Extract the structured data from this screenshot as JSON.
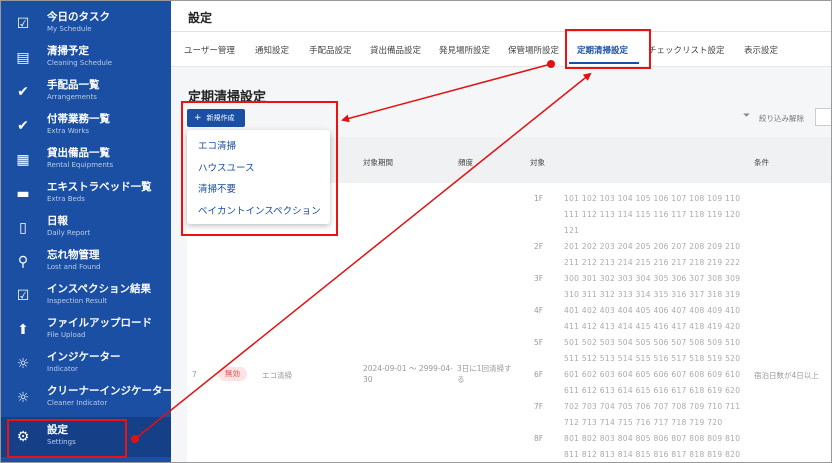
{
  "sidebar": {
    "items": [
      {
        "label": "今日のタスク",
        "sub": "My Schedule",
        "icon": "calendar-check-icon",
        "glyph": "☑"
      },
      {
        "label": "清掃予定",
        "sub": "Cleaning Schedule",
        "icon": "calendar-edit-icon",
        "glyph": "▤"
      },
      {
        "label": "手配品一覧",
        "sub": "Arrangements",
        "icon": "clipboard-check-icon",
        "glyph": "✔"
      },
      {
        "label": "付帯業務一覧",
        "sub": "Extra Works",
        "icon": "clipboard-check-icon",
        "glyph": "✔"
      },
      {
        "label": "貸出備品一覧",
        "sub": "Rental Equipments",
        "icon": "building-icon",
        "glyph": "▦"
      },
      {
        "label": "エキストラベッド一覧",
        "sub": "Extra Beds",
        "icon": "bed-icon",
        "glyph": "▬"
      },
      {
        "label": "日報",
        "sub": "Daily Report",
        "icon": "clipboard-icon",
        "glyph": "▯"
      },
      {
        "label": "忘れ物管理",
        "sub": "Lost and Found",
        "icon": "search-icon",
        "glyph": "⚲"
      },
      {
        "label": "インスペクション結果",
        "sub": "Inspection Result",
        "icon": "calendar-check-icon",
        "glyph": "☑"
      },
      {
        "label": "ファイルアップロード",
        "sub": "File Upload",
        "icon": "upload-icon",
        "glyph": "⬆"
      },
      {
        "label": "インジケーター",
        "sub": "Indicator",
        "icon": "sun-icon",
        "glyph": "☼"
      },
      {
        "label": "クリーナーインジケーター",
        "sub": "Cleaner Indicator",
        "icon": "sun-icon",
        "glyph": "☼"
      },
      {
        "label": "設定",
        "sub": "Settings",
        "icon": "gear-icon",
        "glyph": "⚙"
      }
    ]
  },
  "header": {
    "title": "設定"
  },
  "tabs": [
    {
      "label": "ユーザー管理"
    },
    {
      "label": "通知設定"
    },
    {
      "label": "手配品設定"
    },
    {
      "label": "貸出備品設定"
    },
    {
      "label": "発見場所設定"
    },
    {
      "label": "保管場所設定"
    },
    {
      "label": "定期清掃設定"
    },
    {
      "label": "チェックリスト設定"
    },
    {
      "label": "表示設定"
    }
  ],
  "active_tab": "定期清掃設定",
  "section": {
    "title": "定期清掃設定",
    "new_button": "新規作成",
    "filter_clear": "絞り込み解除"
  },
  "dropdown": {
    "options": [
      "エコ清掃",
      "ハウスユース",
      "清掃不要",
      "ベイカントインスペクション"
    ]
  },
  "table": {
    "headers": {
      "period": "対象期間",
      "frequency": "頻度",
      "target": "対象",
      "condition": "条件"
    },
    "floors": [
      {
        "floor": "1F",
        "rooms": [
          "101 102 103 104 105 106 107 108 109 110",
          "111 112 113 114 115 116 117 118 119 120",
          "121"
        ]
      },
      {
        "floor": "2F",
        "rooms": [
          "201 202 203 204 205 206 207 208 209 210",
          "211 212 213 214 215 216 217 218 219 222"
        ]
      },
      {
        "floor": "3F",
        "rooms": [
          "300 301 302 303 304 305 306 307 308 309",
          "310 311 312 313 314 315 316 317 318 319"
        ]
      },
      {
        "floor": "4F",
        "rooms": [
          "401 402 403 404 405 406 407 408 409 410",
          "411 412 413 414 415 416 417 418 419 420"
        ]
      },
      {
        "floor": "5F",
        "rooms": [
          "501 502 503 504 505 506 507 508 509 510",
          "511 512 513 514 515 516 517 518 519 520"
        ]
      },
      {
        "floor": "6F",
        "rooms": [
          "601 602 603 604 605 606 607 608 609 610",
          "611 612 613 614 615 616 617 618 619 620"
        ]
      },
      {
        "floor": "7F",
        "rooms": [
          "702 703 704 705 706 707 708 709 710 711",
          "712 713 714 715 716 717 718 719 720"
        ]
      },
      {
        "floor": "8F",
        "rooms": [
          "801 802 803 804 805 806 807 808 809 810",
          "811 812 813 814 815 816 817 818 819 820"
        ]
      }
    ],
    "row": {
      "number": "7",
      "status": "無効",
      "type": "エコ清掃",
      "period_line1": "2024-09-01 〜 2999-04-",
      "period_line2": "30",
      "frequency_line1": "3日に1回清掃す",
      "frequency_line2": "る",
      "condition": "宿泊日数が4日以上"
    }
  },
  "colors": {
    "primary": "#1a4fa3",
    "annotation": "#e11111",
    "badge_bg": "#fde3e3",
    "badge_text": "#d9534f"
  }
}
